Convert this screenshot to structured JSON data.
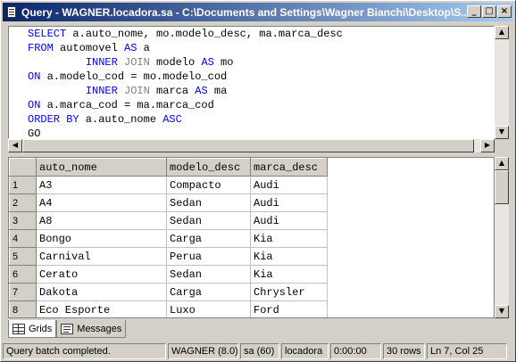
{
  "window": {
    "title": "Query - WAGNER.locadora.sa - C:\\Documents and Settings\\Wagner Bianchi\\Desktop\\S..."
  },
  "titlebar_buttons": {
    "minimize": "_",
    "maximize": "□",
    "close": "×"
  },
  "sql": {
    "lines": [
      [
        {
          "t": "SELECT",
          "c": "kw"
        },
        {
          "t": " a.auto_nome, mo.modelo_desc, ma.marca_desc",
          "c": ""
        }
      ],
      [
        {
          "t": "FROM",
          "c": "kw"
        },
        {
          "t": " automovel ",
          "c": ""
        },
        {
          "t": "AS",
          "c": "kw"
        },
        {
          "t": " a",
          "c": ""
        }
      ],
      [
        {
          "t": "         ",
          "c": ""
        },
        {
          "t": "INNER",
          "c": "kw"
        },
        {
          "t": " ",
          "c": ""
        },
        {
          "t": "JOIN",
          "c": "op"
        },
        {
          "t": " modelo ",
          "c": ""
        },
        {
          "t": "AS",
          "c": "kw"
        },
        {
          "t": " mo",
          "c": ""
        }
      ],
      [
        {
          "t": "ON",
          "c": "kw"
        },
        {
          "t": " a.modelo_cod = mo.modelo_cod",
          "c": ""
        }
      ],
      [
        {
          "t": "         ",
          "c": ""
        },
        {
          "t": "INNER",
          "c": "kw"
        },
        {
          "t": " ",
          "c": ""
        },
        {
          "t": "JOIN",
          "c": "op"
        },
        {
          "t": " marca ",
          "c": ""
        },
        {
          "t": "AS",
          "c": "kw"
        },
        {
          "t": " ma",
          "c": ""
        }
      ],
      [
        {
          "t": "ON",
          "c": "kw"
        },
        {
          "t": " a.marca_cod = ma.marca_cod",
          "c": ""
        }
      ],
      [
        {
          "t": "ORDER BY",
          "c": "kw"
        },
        {
          "t": " a.auto_nome ",
          "c": ""
        },
        {
          "t": "ASC",
          "c": "kw"
        }
      ],
      [
        {
          "t": "GO",
          "c": ""
        }
      ]
    ]
  },
  "grid": {
    "columns": [
      "auto_nome",
      "modelo_desc",
      "marca_desc"
    ],
    "rows": [
      [
        "1",
        "A3",
        "Compacto",
        "Audi"
      ],
      [
        "2",
        "A4",
        "Sedan",
        "Audi"
      ],
      [
        "3",
        "A8",
        "Sedan",
        "Audi"
      ],
      [
        "4",
        "Bongo",
        "Carga",
        "Kia"
      ],
      [
        "5",
        "Carnival",
        "Perua",
        "Kia"
      ],
      [
        "6",
        "Cerato",
        "Sedan",
        "Kia"
      ],
      [
        "7",
        "Dakota",
        "Carga",
        "Chrysler"
      ],
      [
        "8",
        "Eco Esporte",
        "Luxo",
        "Ford"
      ]
    ]
  },
  "tabs": {
    "grids": "Grids",
    "messages": "Messages"
  },
  "status": {
    "message": "Query batch completed.",
    "server": "WAGNER (8.0)",
    "user": "sa (60)",
    "database": "locadora",
    "elapsed": "0:00:00",
    "rows": "30 rows",
    "position": "Ln 7, Col 25"
  },
  "colors": {
    "keyword": "#0000ff",
    "operator": "#808080",
    "title_start": "#0a246a",
    "title_end": "#a6caf0"
  }
}
